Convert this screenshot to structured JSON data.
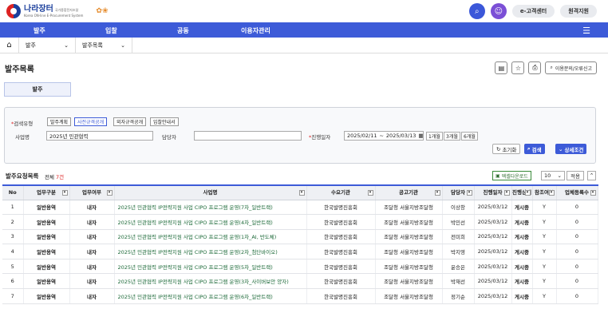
{
  "header": {
    "logo_main": "나라장터",
    "logo_kor_sub": "국가종합전자조달",
    "logo_eng_sub": "Korea ON-line E-Procurement System",
    "customer_center": "e-고객센터",
    "remote_support": "원격지원"
  },
  "nav": {
    "items": [
      "발주",
      "입찰",
      "공동",
      "이용자관리"
    ]
  },
  "breadcrumb": {
    "level1": "발주",
    "level2": "발주목록"
  },
  "page": {
    "title": "발주목록",
    "consult_label": "이용문의/오류신고",
    "tab_label": "발주"
  },
  "search": {
    "type_label": "검색유형",
    "types": [
      "발주계획",
      "사전규격공개",
      "외자규격공개",
      "입찰안내서"
    ],
    "project_label": "사업명",
    "project_value": "2025년 민관협력",
    "manager_label": "담당자",
    "manager_value": "",
    "date_label": "진행일자",
    "date_from": "2025/02/11",
    "date_sep": "~",
    "date_to": "2025/03/13",
    "periods": [
      "1개월",
      "3개월",
      "6개월"
    ],
    "reset_label": "초기화",
    "search_label": "검색",
    "detail_label": "상세조건"
  },
  "list": {
    "title": "발주요청목록",
    "count_prefix": "전체",
    "count": "7건",
    "excel_label": "엑셀다운로드",
    "page_size": "10",
    "apply_label": "적용",
    "columns": [
      "No",
      "업무구분",
      "업무여부",
      "사업명",
      "수요기관",
      "공고기관",
      "담당자",
      "진행일자",
      "진행상태",
      "참조여부",
      "업체등록수"
    ],
    "rows": [
      [
        "1",
        "일반용역",
        "내자",
        "2025년 민관협력 IP전략지원 사업 CIPO 프로그램 운영(7차_일반트랙)",
        "한국발명진흥회",
        "조달청 서울지방조달청",
        "이상창",
        "2025/03/12",
        "게시중",
        "Y",
        "0"
      ],
      [
        "2",
        "일반용역",
        "내자",
        "2025년 민관협력 IP전략지원 사업 CIPO 프로그램 운영(4차_일반트랙)",
        "한국발명진흥회",
        "조달청 서울지방조달청",
        "박민선",
        "2025/03/12",
        "게시중",
        "Y",
        "0"
      ],
      [
        "3",
        "일반용역",
        "내자",
        "2025년 민관협력 IP전략지원 사업 CIPO 프로그램 운영(1차_AI, 반도체)",
        "한국발명진흥회",
        "조달청 서울지방조달청",
        "전미희",
        "2025/03/12",
        "게시중",
        "Y",
        "0"
      ],
      [
        "4",
        "일반용역",
        "내자",
        "2025년 민관협력 IP전략지원 사업 CIPO 프로그램 운영(2차_첨단바이오)",
        "한국발명진흥회",
        "조달청 서울지방조달청",
        "박지영",
        "2025/03/12",
        "게시중",
        "Y",
        "0"
      ],
      [
        "5",
        "일반용역",
        "내자",
        "2025년 민관협력 IP전략지원 사업 CIPO 프로그램 운영(5차_일반트랙)",
        "한국발명진흥회",
        "조달청 서울지방조달청",
        "윤승은",
        "2025/03/12",
        "게시중",
        "Y",
        "0"
      ],
      [
        "6",
        "일반용역",
        "내자",
        "2025년 민관협력 IP전략지원 사업 CIPO 프로그램 운영(3차_사이버보안 양자)",
        "한국발명진흥회",
        "조달청 서울지방조달청",
        "박재선",
        "2025/03/12",
        "게시중",
        "Y",
        "0"
      ],
      [
        "7",
        "일반용역",
        "내자",
        "2025년 민관협력 IP전략지원 사업 CIPO 프로그램 운영(6차_일반트랙)",
        "한국발명진흥회",
        "조달청 서울지방조달청",
        "정기순",
        "2025/03/12",
        "게시중",
        "Y",
        "0"
      ]
    ]
  },
  "colors": {
    "primary": "#3d5bd8",
    "purple": "#7b4fd6",
    "link_green": "#1e6b3a",
    "required_red": "#dd2222"
  }
}
